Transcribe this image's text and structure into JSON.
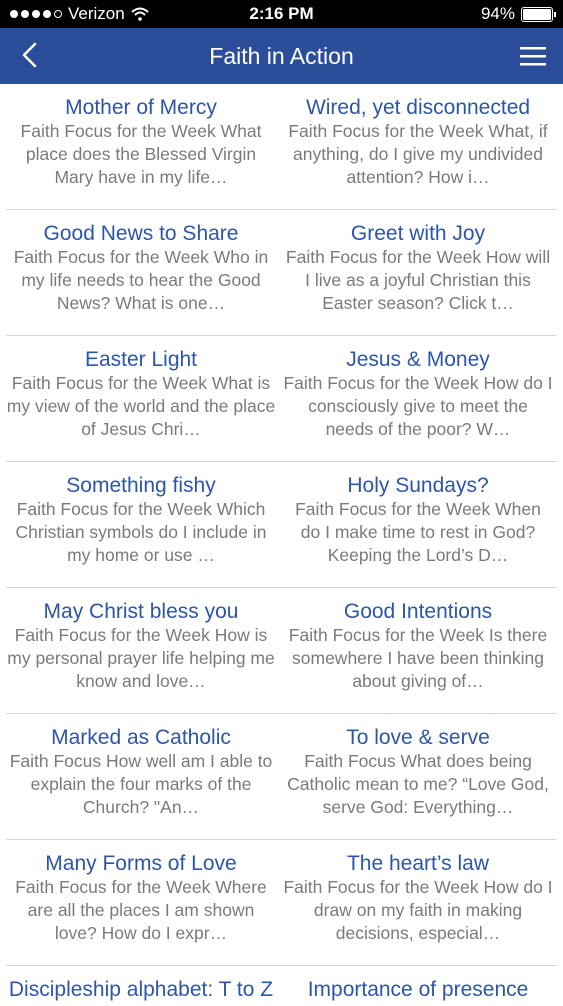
{
  "status_bar": {
    "carrier": "Verizon",
    "time": "2:16 PM",
    "battery": "94%"
  },
  "header": {
    "title": "Faith in Action"
  },
  "articles": [
    {
      "title": "Mother of Mercy",
      "desc": "Faith Focus for the Week What place does the Blessed Virgin Mary have in my life…"
    },
    {
      "title": "Wired, yet disconnected",
      "desc": "Faith Focus for the Week What, if anything, do I give my undivided attention? How i…"
    },
    {
      "title": "Good News to Share",
      "desc": "Faith Focus for the Week Who in my life needs to hear the Good News? What is one…"
    },
    {
      "title": "Greet with Joy",
      "desc": "Faith Focus for the Week How will I live as a joyful Christian this Easter season? Click t…"
    },
    {
      "title": "Easter Light",
      "desc": "Faith Focus for the Week What is my view of the world and the place of Jesus Chri…"
    },
    {
      "title": "Jesus & Money",
      "desc": "Faith Focus for the Week How do I consciously give to meet the needs of the poor? W…"
    },
    {
      "title": "Something fishy",
      "desc": "Faith Focus for the Week Which Christian symbols do I include in my home or use …"
    },
    {
      "title": "Holy Sundays?",
      "desc": "Faith Focus for the Week When do I make time to rest in God?  Keeping the Lord’s D…"
    },
    {
      "title": "May Christ bless you",
      "desc": "Faith Focus for the Week How is my personal prayer life helping me know and love…"
    },
    {
      "title": "Good Intentions",
      "desc": "Faith Focus for the Week Is there somewhere I have been thinking about giving of…"
    },
    {
      "title": "Marked as Catholic",
      "desc": "Faith Focus How well am I able to explain the four marks of the Church? \"An…"
    },
    {
      "title": "To love & serve",
      "desc": "Faith Focus What does being Catholic mean to me? “Love God, serve God: Everything…"
    },
    {
      "title": "Many Forms of Love",
      "desc": "Faith Focus for the Week Where are all the places I am shown love? How do I expr…"
    },
    {
      "title": "The heart’s law",
      "desc": "Faith Focus for the Week How do I draw on my faith in making decisions, especial…"
    },
    {
      "title": "Discipleship alphabet: T to Z",
      "desc": ""
    },
    {
      "title": "Importance of presence",
      "desc": ""
    }
  ]
}
